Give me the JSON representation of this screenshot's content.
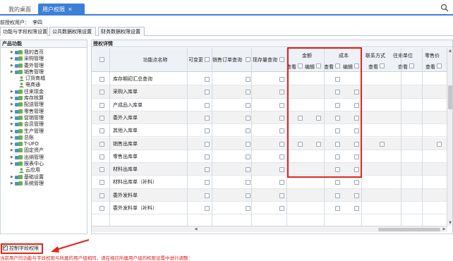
{
  "tabs": {
    "home": "我的桌面",
    "active": "用户权限",
    "close": "✕"
  },
  "user_line": {
    "label": "前授权用户：",
    "value": "李四"
  },
  "sub_tabs": [
    "功能与字段权限设置",
    "公共数据权限设置",
    "财务数据权限设置"
  ],
  "left_panel": {
    "title": "产品功能",
    "items": [
      {
        "label": "我的首页",
        "icon": "module-icon",
        "expandable": true
      },
      {
        "label": "采购管理",
        "icon": "module-icon",
        "expandable": true
      },
      {
        "label": "委外管理",
        "icon": "module-icon",
        "expandable": true
      },
      {
        "label": "销售管理",
        "icon": "module-icon",
        "expandable": true
      },
      {
        "label": "订货商城",
        "icon": "user-icon",
        "expandable": false
      },
      {
        "label": "电商通",
        "icon": "user-icon",
        "expandable": false
      },
      {
        "label": "往来现金",
        "icon": "module-icon",
        "expandable": true
      },
      {
        "label": "库存核算",
        "icon": "module-icon",
        "expandable": true
      },
      {
        "label": "配送管理",
        "icon": "module-icon",
        "expandable": true
      },
      {
        "label": "零售管理",
        "icon": "module-icon",
        "expandable": true
      },
      {
        "label": "促销管理",
        "icon": "module-icon",
        "expandable": true
      },
      {
        "label": "会员管理",
        "icon": "module-icon",
        "expandable": true
      },
      {
        "label": "生产管理",
        "icon": "module-icon",
        "expandable": true
      },
      {
        "label": "总账",
        "icon": "module-icon",
        "expandable": true
      },
      {
        "label": "T-UFO",
        "icon": "module-icon",
        "expandable": true
      },
      {
        "label": "固定资产",
        "icon": "module-icon",
        "expandable": true
      },
      {
        "label": "出纳管理",
        "icon": "module-icon",
        "expandable": true
      },
      {
        "label": "报表中心",
        "icon": "module-icon",
        "expandable": true
      },
      {
        "label": "云应用",
        "icon": "user-icon",
        "expandable": false
      },
      {
        "label": "基础设置",
        "icon": "module-icon",
        "expandable": true
      },
      {
        "label": "系统管理",
        "icon": "module-icon",
        "expandable": true
      }
    ]
  },
  "right_panel": {
    "title": "授权详情",
    "columns": {
      "name": "功能点名称",
      "change": "可变更",
      "sales_order_query": "销售订单查询",
      "stock_query": "现存量查询",
      "amount_group": "金额",
      "cost_group": "成本",
      "view": "查看",
      "edit": "编辑",
      "contact": "联系方式",
      "unit": "往来单位",
      "retail_price": "零售价"
    },
    "rows": [
      {
        "name": "库存期初汇总查询",
        "checks": [
          "cost_view"
        ]
      },
      {
        "name": "采购入库单",
        "checks": [
          "cost_view",
          "cost_edit"
        ]
      },
      {
        "name": "产成品入库单",
        "checks": [
          "cost_view",
          "cost_edit"
        ]
      },
      {
        "name": "委外入库单",
        "checks": [
          "amount_view",
          "amount_edit",
          "cost_view",
          "cost_edit"
        ]
      },
      {
        "name": "其他入库单",
        "checks": [
          "cost_view",
          "cost_edit"
        ]
      },
      {
        "name": "销售出库单",
        "checks": [
          "amount_view",
          "amount_edit",
          "cost_view",
          "cost_edit",
          "contact_view",
          "retail_view"
        ]
      },
      {
        "name": "零售出库单",
        "checks": [
          "cost_view",
          "cost_edit"
        ]
      },
      {
        "name": "材料出库单",
        "checks": [
          "cost_view",
          "cost_edit"
        ]
      },
      {
        "name": "材料出库单（补料）",
        "checks": [
          "cost_view",
          "cost_edit"
        ]
      },
      {
        "name": "委外发料单",
        "checks": [
          "cost_view",
          "cost_edit"
        ]
      },
      {
        "name": "委外发料单（补料）",
        "checks": [
          "cost_view",
          "cost_edit"
        ]
      }
    ]
  },
  "bottom": {
    "checkbox_label": "控制字段权限",
    "checked": true,
    "notice": "当前用户的功能与字段权限与所属的用户组相同，请在相应所属用户组的权限设置中进行调整："
  },
  "colors": {
    "accent": "#3c7fd6",
    "annotation": "#e2231a",
    "notice": "#d9261c"
  }
}
